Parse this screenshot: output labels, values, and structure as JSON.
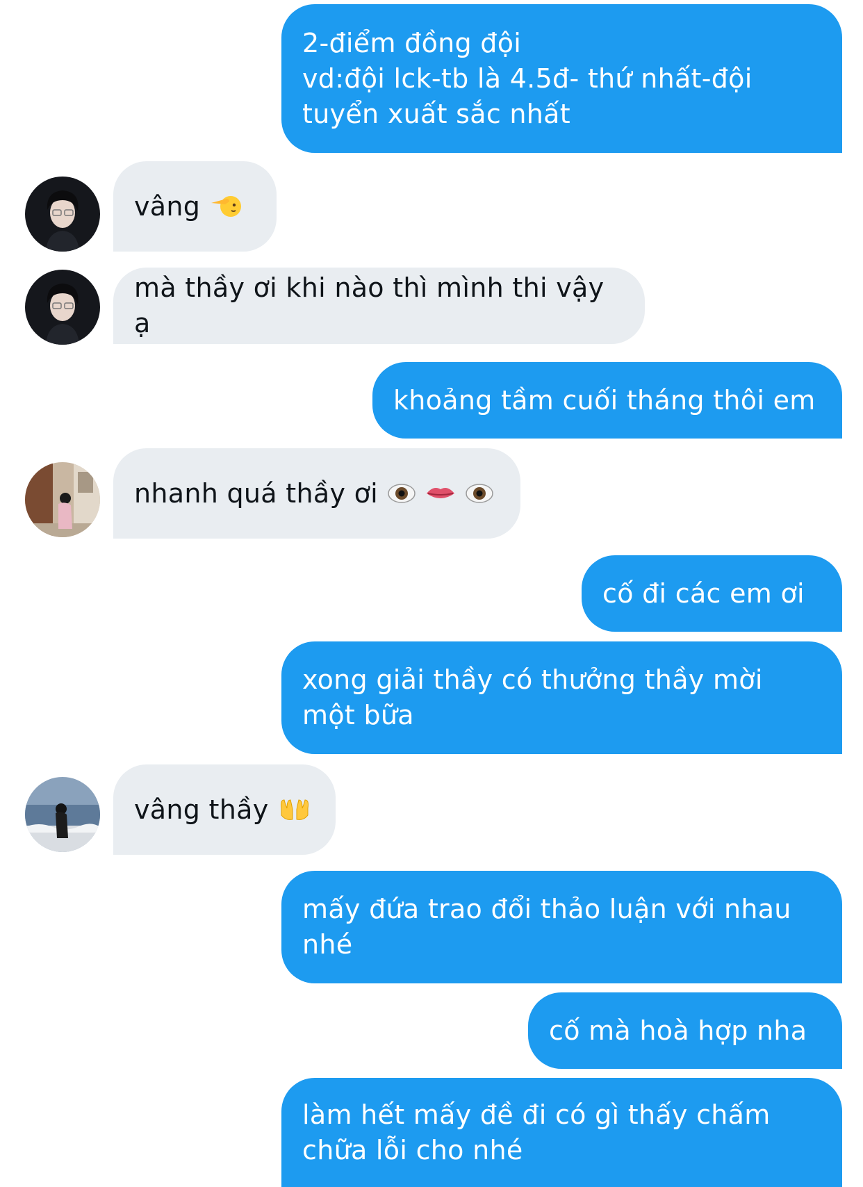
{
  "conversation": {
    "messages": [
      {
        "sender": "me",
        "text": "2-điểm đồng đội\nvd:đội lck-tb là 4.5đ- thứ nhất-đội\ntuyển xuất sắc nhất"
      },
      {
        "sender": "member_1",
        "text": "vâng",
        "emoji": "saluting-face"
      },
      {
        "sender": "member_1",
        "text": "mà thầy ơi khi nào thì mình thi vậy ạ"
      },
      {
        "sender": "me",
        "text": "khoảng tầm cuối tháng thôi em"
      },
      {
        "sender": "member_2",
        "text": "nhanh quá thầy ơi",
        "emoji": "eye-mouth-eye"
      },
      {
        "sender": "me",
        "text": "cố đi các em ơi"
      },
      {
        "sender": "me",
        "text": "xong giải thầy có thưởng thầy mời\nmột bữa"
      },
      {
        "sender": "member_3",
        "text": "vâng thầy",
        "emoji": "palms-up-together"
      },
      {
        "sender": "me",
        "text": "mấy đứa trao đổi thảo luận với nhau\nnhé"
      },
      {
        "sender": "me",
        "text": "cố mà hoà hợp nha"
      },
      {
        "sender": "me",
        "text": "làm hết mấy đề đi có gì thấy chấm\nchữa lỗi cho nhé"
      }
    ]
  },
  "colors": {
    "outgoing_bubble": "#1d9bf0",
    "incoming_bubble": "#e9edf1",
    "incoming_text": "#0f1419",
    "outgoing_text": "#ffffff"
  }
}
